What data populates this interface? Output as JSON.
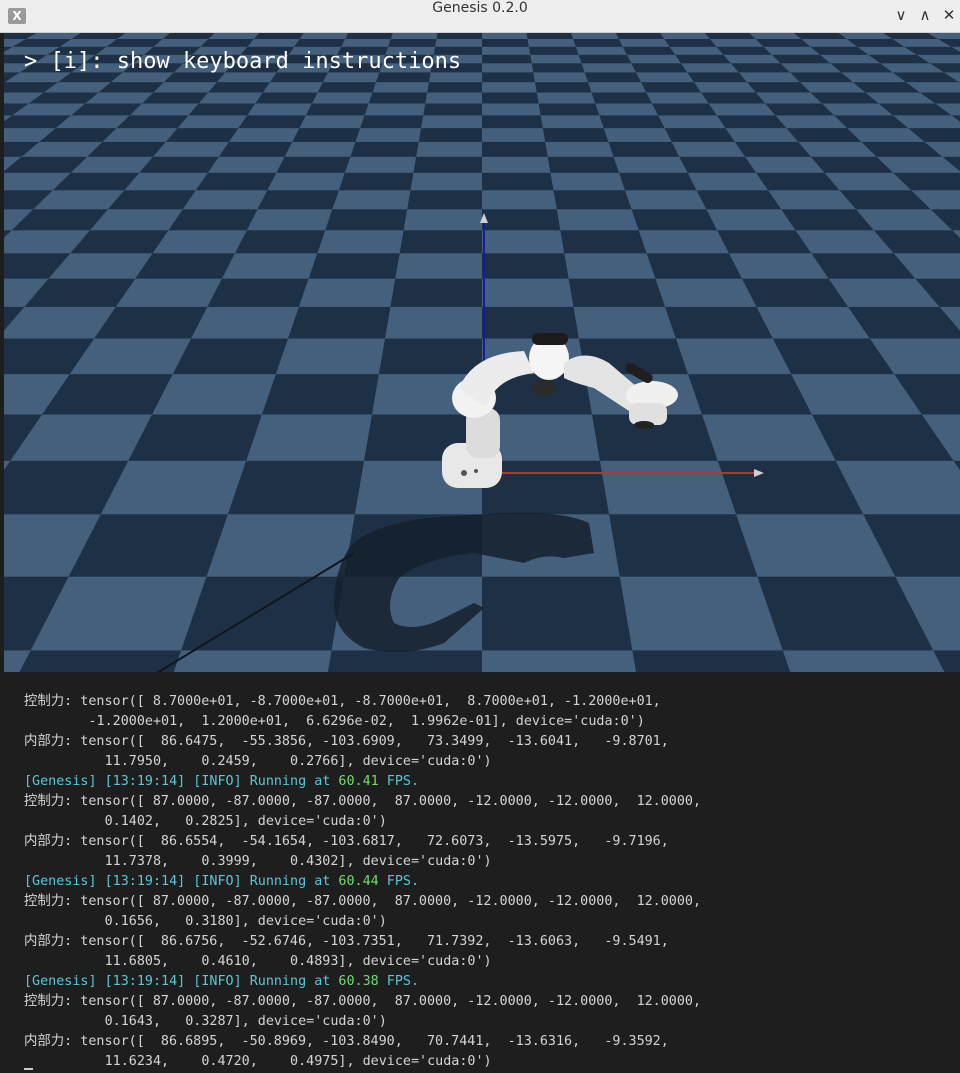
{
  "window": {
    "title": "Genesis 0.2.0",
    "app_icon": "x11-icon",
    "controls": [
      "minimize-icon",
      "maximize-icon",
      "close-icon"
    ],
    "control_glyphs": {
      "minimize": "∨",
      "maximize": "∧",
      "close": "✕"
    }
  },
  "viewport": {
    "hint": "> [i]: show keyboard instructions",
    "floor_colors": {
      "light": "#45607d",
      "dark": "#1e3045"
    },
    "axis_colors": {
      "z": "#1a1aa0",
      "x": "#c03030"
    }
  },
  "terminal": {
    "lines": [
      {
        "type": "plain",
        "text": "控制力: tensor([ 8.7000e+01, -8.7000e+01, -8.7000e+01,  8.7000e+01, -1.2000e+01,"
      },
      {
        "type": "plain",
        "text": "        -1.2000e+01,  1.2000e+01,  6.6296e-02,  1.9962e-01], device='cuda:0')"
      },
      {
        "type": "plain",
        "text": "内部力: tensor([  86.6475,  -55.3856, -103.6909,   73.3499,  -13.6041,   -9.8701,"
      },
      {
        "type": "plain",
        "text": "          11.7950,    0.2459,    0.2766], device='cuda:0')"
      },
      {
        "type": "log",
        "prefix": "[Genesis] [13:19:14] [INFO] Running at ",
        "value": "60.41",
        "suffix": " FPS."
      },
      {
        "type": "plain",
        "text": "控制力: tensor([ 87.0000, -87.0000, -87.0000,  87.0000, -12.0000, -12.0000,  12.0000,"
      },
      {
        "type": "plain",
        "text": "          0.1402,   0.2825], device='cuda:0')"
      },
      {
        "type": "plain",
        "text": "内部力: tensor([  86.6554,  -54.1654, -103.6817,   72.6073,  -13.5975,   -9.7196,"
      },
      {
        "type": "plain",
        "text": "          11.7378,    0.3999,    0.4302], device='cuda:0')"
      },
      {
        "type": "log",
        "prefix": "[Genesis] [13:19:14] [INFO] Running at ",
        "value": "60.44",
        "suffix": " FPS."
      },
      {
        "type": "plain",
        "text": "控制力: tensor([ 87.0000, -87.0000, -87.0000,  87.0000, -12.0000, -12.0000,  12.0000,"
      },
      {
        "type": "plain",
        "text": "          0.1656,   0.3180], device='cuda:0')"
      },
      {
        "type": "plain",
        "text": "内部力: tensor([  86.6756,  -52.6746, -103.7351,   71.7392,  -13.6063,   -9.5491,"
      },
      {
        "type": "plain",
        "text": "          11.6805,    0.4610,    0.4893], device='cuda:0')"
      },
      {
        "type": "log",
        "prefix": "[Genesis] [13:19:14] [INFO] Running at ",
        "value": "60.38",
        "suffix": " FPS."
      },
      {
        "type": "plain",
        "text": "控制力: tensor([ 87.0000, -87.0000, -87.0000,  87.0000, -12.0000, -12.0000,  12.0000,"
      },
      {
        "type": "plain",
        "text": "          0.1643,   0.3287], device='cuda:0')"
      },
      {
        "type": "plain",
        "text": "内部力: tensor([  86.6895,  -50.8969, -103.8490,   70.7441,  -13.6316,   -9.3592,"
      },
      {
        "type": "plain",
        "text": "          11.6234,    0.4720,    0.4975], device='cuda:0')"
      }
    ]
  }
}
